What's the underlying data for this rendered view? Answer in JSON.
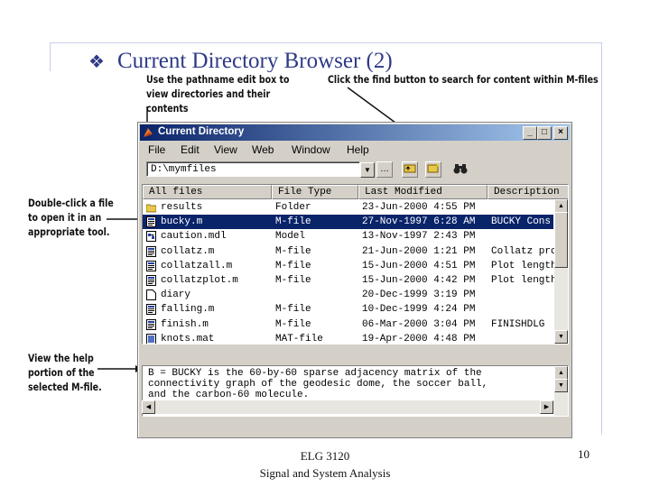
{
  "slide": {
    "bullet": "❖",
    "title": "Current Directory Browser (2)",
    "footer_line1": "ELG 3120",
    "footer_line2": "Signal and System Analysis",
    "page_number": "10"
  },
  "callouts": {
    "pathname": "Use the pathname edit box to view directories and their contents",
    "find": "Click the find button to search for content within M-files",
    "doubleclick": "Double-click a file to open it in an appropriate tool.",
    "help": "View the help portion of the selected M-file."
  },
  "window": {
    "title": "Current Directory",
    "menu": [
      "File",
      "Edit",
      "View",
      "Web",
      "Window",
      "Help"
    ],
    "path_value": "D:\\mymfiles",
    "columns": [
      "All files",
      "File Type",
      "Last Modified",
      "Description"
    ],
    "rows": [
      {
        "name": "results",
        "type": "Folder",
        "modified": "23-Jun-2000  4:55 PM",
        "desc": "",
        "icon": "folder-icon",
        "selected": false
      },
      {
        "name": "bucky.m",
        "type": "M-file",
        "modified": "27-Nov-1997  6:28 AM",
        "desc": "BUCKY  Cons",
        "icon": "mfile-icon",
        "selected": true
      },
      {
        "name": "caution.mdl",
        "type": "Model",
        "modified": "13-Nov-1997  2:43 PM",
        "desc": "",
        "icon": "model-icon",
        "selected": false
      },
      {
        "name": "collatz.m",
        "type": "M-file",
        "modified": "21-Jun-2000  1:21 PM",
        "desc": "Collatz pro",
        "icon": "mfile-icon",
        "selected": false
      },
      {
        "name": "collatzall.m",
        "type": "M-file",
        "modified": "15-Jun-2000  4:51 PM",
        "desc": "Plot length",
        "icon": "mfile-icon",
        "selected": false
      },
      {
        "name": "collatzplot.m",
        "type": "M-file",
        "modified": "15-Jun-2000  4:42 PM",
        "desc": "Plot length",
        "icon": "mfile-icon",
        "selected": false
      },
      {
        "name": "diary",
        "type": "",
        "modified": "20-Dec-1999  3:19 PM",
        "desc": "",
        "icon": "file-icon",
        "selected": false
      },
      {
        "name": "falling.m",
        "type": "M-file",
        "modified": "10-Dec-1999  4:24 PM",
        "desc": "",
        "icon": "mfile-icon",
        "selected": false
      },
      {
        "name": "finish.m",
        "type": "M-file",
        "modified": "06-Mar-2000  3:04 PM",
        "desc": "FINISHDLG",
        "icon": "mfile-icon",
        "selected": false
      },
      {
        "name": "knots.mat",
        "type": "MAT-file",
        "modified": "19-Apr-2000  4:48 PM",
        "desc": "",
        "icon": "matfile-icon",
        "selected": false
      }
    ],
    "help_text": "B = BUCKY is the 60-by-60 sparse adjacency matrix of the\nconnectivity graph of the geodesic dome, the soccer ball,\nand the carbon-60 molecule."
  },
  "colors": {
    "title_blue": "#2f3a86",
    "selection": "#0a246a",
    "window_face": "#d4d0c8"
  }
}
